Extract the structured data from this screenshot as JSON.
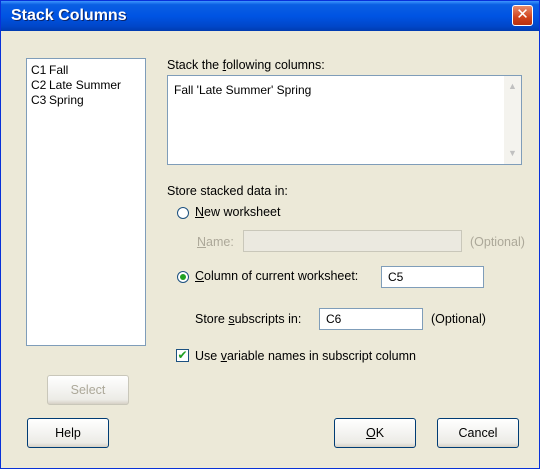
{
  "window": {
    "title": "Stack Columns",
    "close_glyph": "✕"
  },
  "columns_list": [
    {
      "col": "C1",
      "name": "Fall"
    },
    {
      "col": "C2",
      "name": "Late Summer"
    },
    {
      "col": "C3",
      "name": "Spring"
    }
  ],
  "stack": {
    "label_pre": "Stack the ",
    "label_key": "f",
    "label_post": "ollowing columns:",
    "value": "Fall 'Late Summer' Spring"
  },
  "store": {
    "label": "Store stacked data in:",
    "new_worksheet": {
      "key": "N",
      "rest": "ew worksheet",
      "selected": false
    },
    "name": {
      "key": "N",
      "rest": "ame:",
      "value": "",
      "optional": "(Optional)"
    },
    "column_current": {
      "key": "C",
      "rest": "olumn of current worksheet:",
      "selected": true,
      "value": "C5"
    },
    "subscripts": {
      "pre": "Store ",
      "key": "s",
      "rest": "ubscripts in:",
      "value": "C6",
      "optional": "(Optional)"
    }
  },
  "use_varnames": {
    "checked": true,
    "pre": "Use ",
    "key": "v",
    "rest": "ariable names in subscript column",
    "check_glyph": "✔"
  },
  "buttons": {
    "select": "Select",
    "help": "Help",
    "ok_key": "O",
    "ok_rest": "K",
    "cancel": "Cancel"
  }
}
